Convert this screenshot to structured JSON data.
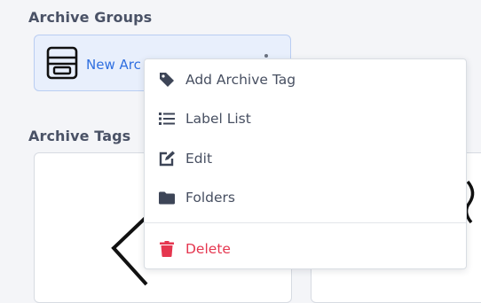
{
  "archive_groups": {
    "title": "Archive Groups",
    "group": {
      "name": "New Arc",
      "icon": "file-cabinet-icon"
    }
  },
  "archive_tags": {
    "title": "Archive Tags"
  },
  "context_menu": {
    "items": [
      {
        "label": "Add Archive Tag",
        "icon": "tag-icon"
      },
      {
        "label": "Label List",
        "icon": "list-icon"
      },
      {
        "label": "Edit",
        "icon": "edit-icon"
      },
      {
        "label": "Folders",
        "icon": "folder-icon"
      },
      {
        "label": "Delete",
        "icon": "trash-icon",
        "color": "#e5364f"
      }
    ]
  },
  "colors": {
    "accent": "#2f6fe0",
    "danger": "#e5364f",
    "card_bg": "#e8effc"
  }
}
